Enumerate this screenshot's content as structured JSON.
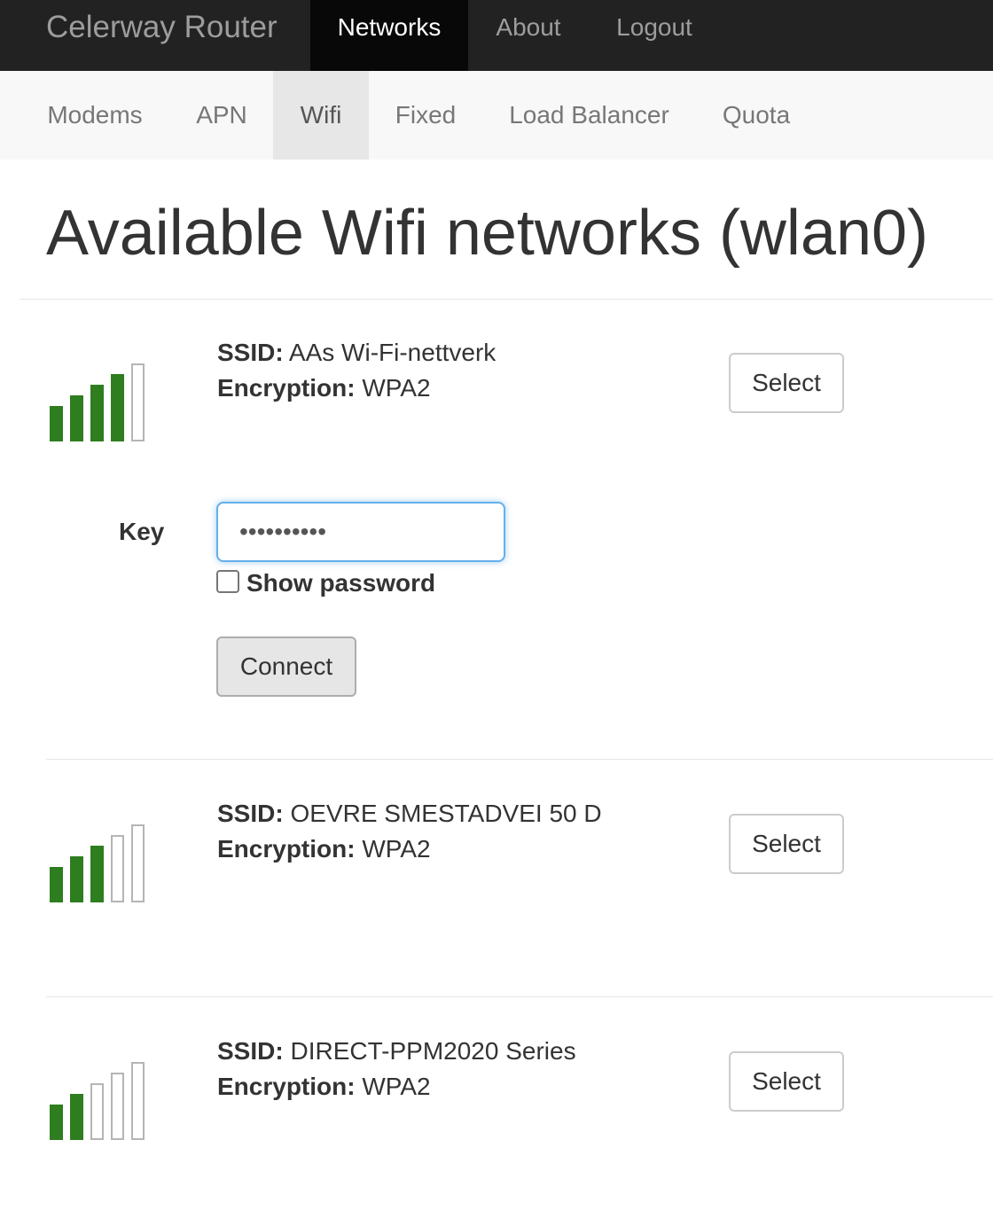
{
  "navbar": {
    "brand": "Celerway Router",
    "items": [
      {
        "label": "Networks",
        "active": true
      },
      {
        "label": "About",
        "active": false
      },
      {
        "label": "Logout",
        "active": false
      }
    ]
  },
  "subnav": {
    "items": [
      {
        "label": "Modems",
        "active": false
      },
      {
        "label": "APN",
        "active": false
      },
      {
        "label": "Wifi",
        "active": true
      },
      {
        "label": "Fixed",
        "active": false
      },
      {
        "label": "Load Balancer",
        "active": false
      },
      {
        "label": "Quota",
        "active": false
      }
    ]
  },
  "page": {
    "title": "Available Wifi networks (wlan0)"
  },
  "labels": {
    "ssid": "SSID:",
    "encryption": "Encryption:",
    "select": "Select",
    "key": "Key",
    "show_password": "Show password",
    "connect": "Connect"
  },
  "networks": [
    {
      "ssid": "AAs Wi-Fi-nettverk",
      "encryption": "WPA2",
      "signal_bars": 4,
      "signal_max": 5
    },
    {
      "ssid": "OEVRE SMESTADVEI 50 D",
      "encryption": "WPA2",
      "signal_bars": 3,
      "signal_max": 5
    },
    {
      "ssid": "DIRECT-PPM2020 Series",
      "encryption": "WPA2",
      "signal_bars": 2,
      "signal_max": 5
    }
  ],
  "key_form": {
    "value": "••••••••••",
    "show_password": false
  },
  "colors": {
    "navbar_bg": "#222222",
    "signal_on": "#2e7d1f",
    "focus_border": "#66afe9"
  }
}
